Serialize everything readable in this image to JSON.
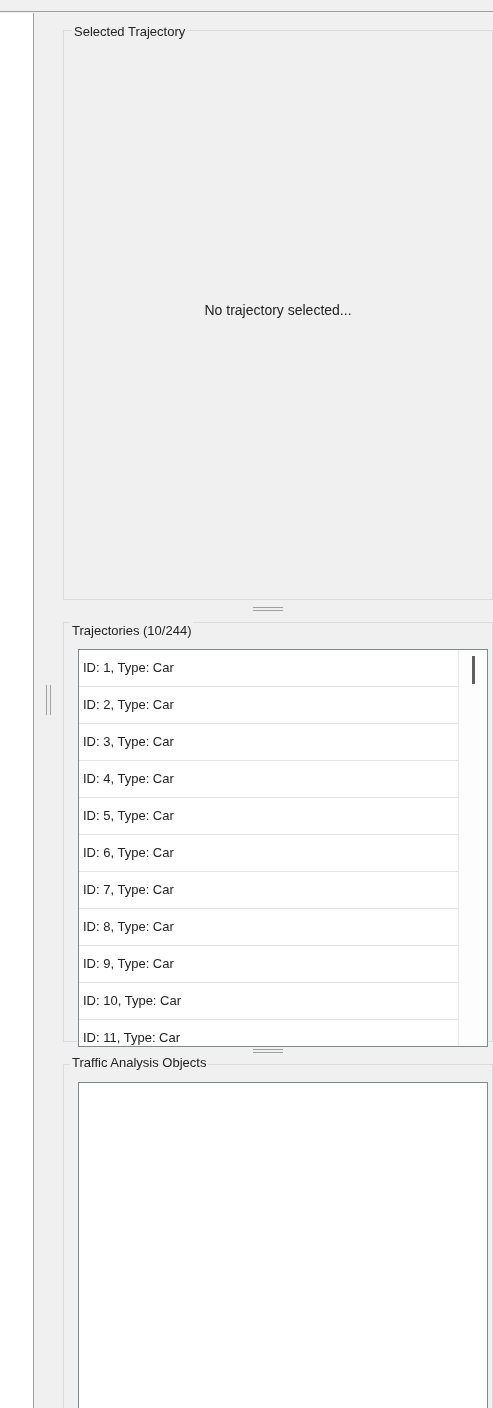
{
  "selected_trajectory": {
    "title": "Selected Trajectory",
    "message": "No trajectory selected..."
  },
  "trajectories": {
    "title": "Trajectories (10/244)",
    "items": [
      {
        "label": "ID: 1, Type: Car"
      },
      {
        "label": "ID: 2, Type: Car"
      },
      {
        "label": "ID: 3, Type: Car"
      },
      {
        "label": "ID: 4, Type: Car"
      },
      {
        "label": "ID: 5, Type: Car"
      },
      {
        "label": "ID: 6, Type: Car"
      },
      {
        "label": "ID: 7, Type: Car"
      },
      {
        "label": "ID: 8, Type: Car"
      },
      {
        "label": "ID: 9, Type: Car"
      },
      {
        "label": "ID: 10, Type: Car"
      },
      {
        "label": "ID: 11, Type: Car"
      }
    ]
  },
  "traffic_analysis_objects": {
    "title": "Traffic Analysis Objects"
  }
}
